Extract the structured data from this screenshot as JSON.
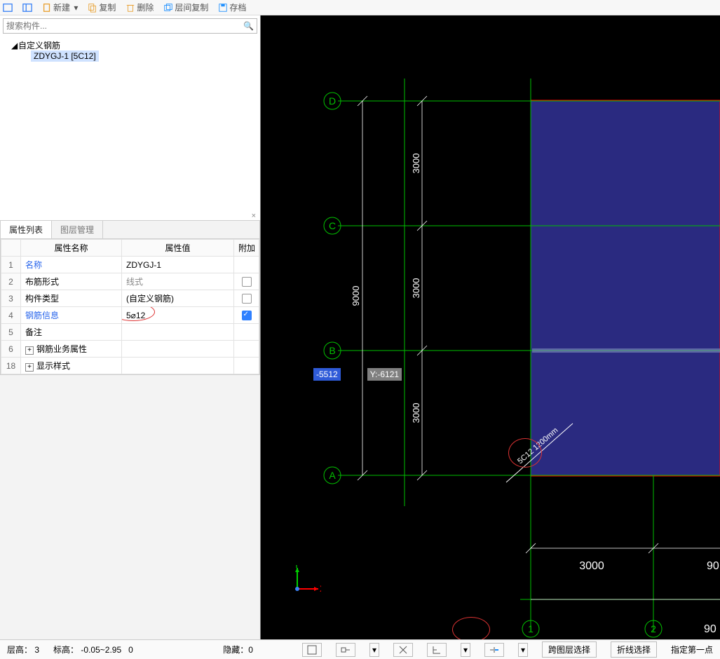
{
  "toolbar": {
    "new": "新建",
    "copy": "复制",
    "delete": "删除",
    "layercopy": "层间复制",
    "save": "存档"
  },
  "search": {
    "placeholder": "搜索构件..."
  },
  "tree": {
    "root": "自定义钢筋",
    "item": "ZDYGJ-1 [5C12]"
  },
  "tabs": {
    "props": "属性列表",
    "layers": "图层管理"
  },
  "grid": {
    "head_name": "属性名称",
    "head_value": "属性值",
    "head_extra": "附加",
    "rows": [
      {
        "idx": "1",
        "name": "名称",
        "value": "ZDYGJ-1",
        "link": true
      },
      {
        "idx": "2",
        "name": "布筋形式",
        "value": "线式",
        "grey": true,
        "chk": true
      },
      {
        "idx": "3",
        "name": "构件类型",
        "value": "(自定义钢筋)",
        "chk": true
      },
      {
        "idx": "4",
        "name": "钢筋信息",
        "value": "5⌀12",
        "link": true,
        "chk": true,
        "checked": true,
        "circle": true
      },
      {
        "idx": "5",
        "name": "备注",
        "value": ""
      },
      {
        "idx": "6",
        "name": "钢筋业务属性",
        "value": "",
        "exp": true
      },
      {
        "idx": "18",
        "name": "显示样式",
        "value": "",
        "exp": true
      }
    ]
  },
  "viewport": {
    "coord_x": "-5512",
    "coord_y": "Y:-6121",
    "dims": {
      "v1": "3000",
      "v2": "3000",
      "v_total": "9000",
      "v3": "3000",
      "h1": "3000",
      "h2": "90"
    },
    "axes_h": [
      "D",
      "C",
      "B",
      "A"
    ],
    "axes_v": [
      "1",
      "2"
    ],
    "rebar": "5C12 1200mm",
    "ucs_x": "X",
    "ucs_y": "Y"
  },
  "status": {
    "floor_lbl": "层高：",
    "floor_val": "3",
    "elev_lbl": "标高：",
    "elev_val": "-0.05~2.95",
    "elev_extra": "0",
    "hide_lbl": "隐藏：",
    "hide_val": "0",
    "cross": "跨图层选择",
    "polyline": "折线选择",
    "hint": "指定第一点"
  },
  "chart_data": null
}
